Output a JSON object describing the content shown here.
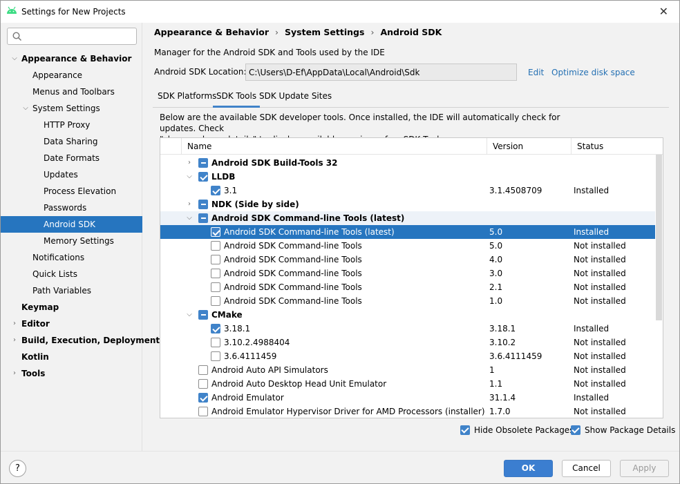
{
  "window": {
    "title": "Settings for New Projects"
  },
  "search": {
    "placeholder": "",
    "value": ""
  },
  "sidebar": {
    "items": [
      {
        "label": "Appearance & Behavior"
      },
      {
        "label": "Appearance"
      },
      {
        "label": "Menus and Toolbars"
      },
      {
        "label": "System Settings"
      },
      {
        "label": "HTTP Proxy"
      },
      {
        "label": "Data Sharing"
      },
      {
        "label": "Date Formats"
      },
      {
        "label": "Updates"
      },
      {
        "label": "Process Elevation"
      },
      {
        "label": "Passwords"
      },
      {
        "label": "Android SDK"
      },
      {
        "label": "Memory Settings"
      },
      {
        "label": "Notifications"
      },
      {
        "label": "Quick Lists"
      },
      {
        "label": "Path Variables"
      },
      {
        "label": "Keymap"
      },
      {
        "label": "Editor"
      },
      {
        "label": "Build, Execution, Deployment"
      },
      {
        "label": "Kotlin"
      },
      {
        "label": "Tools"
      }
    ]
  },
  "breadcrumb": [
    "Appearance & Behavior",
    "System Settings",
    "Android SDK"
  ],
  "main": {
    "description": "Manager for the Android SDK and Tools used by the IDE",
    "location_label": "Android SDK Location:",
    "location_value": "C:\\Users\\D-Ef\\AppData\\Local\\Android\\Sdk",
    "edit_link": "Edit",
    "optimize_link": "Optimize disk space",
    "tabs": [
      {
        "label": "SDK Platforms"
      },
      {
        "label": "SDK Tools"
      },
      {
        "label": "SDK Update Sites"
      }
    ],
    "tab_desc_1": "Below are the available SDK developer tools. Once installed, the IDE will automatically check for updates. Check",
    "tab_desc_2": "\"show package details\" to display available versions of an SDK Tool."
  },
  "table": {
    "columns": [
      "Name",
      "Version",
      "Status"
    ],
    "rows": [
      {
        "name": "Android SDK Build-Tools 32",
        "version": "",
        "status": ""
      },
      {
        "name": "LLDB",
        "version": "",
        "status": ""
      },
      {
        "name": "3.1",
        "version": "3.1.4508709",
        "status": "Installed"
      },
      {
        "name": "NDK (Side by side)",
        "version": "",
        "status": ""
      },
      {
        "name": "Android SDK Command-line Tools (latest)",
        "version": "",
        "status": ""
      },
      {
        "name": "Android SDK Command-line Tools (latest)",
        "version": "5.0",
        "status": "Installed"
      },
      {
        "name": "Android SDK Command-line Tools",
        "version": "5.0",
        "status": "Not installed"
      },
      {
        "name": "Android SDK Command-line Tools",
        "version": "4.0",
        "status": "Not installed"
      },
      {
        "name": "Android SDK Command-line Tools",
        "version": "3.0",
        "status": "Not installed"
      },
      {
        "name": "Android SDK Command-line Tools",
        "version": "2.1",
        "status": "Not installed"
      },
      {
        "name": "Android SDK Command-line Tools",
        "version": "1.0",
        "status": "Not installed"
      },
      {
        "name": "CMake",
        "version": "",
        "status": ""
      },
      {
        "name": "3.18.1",
        "version": "3.18.1",
        "status": "Installed"
      },
      {
        "name": "3.10.2.4988404",
        "version": "3.10.2",
        "status": "Not installed"
      },
      {
        "name": "3.6.4111459",
        "version": "3.6.4111459",
        "status": "Not installed"
      },
      {
        "name": "Android Auto API Simulators",
        "version": "1",
        "status": "Not installed"
      },
      {
        "name": "Android Auto Desktop Head Unit Emulator",
        "version": "1.1",
        "status": "Not installed"
      },
      {
        "name": "Android Emulator",
        "version": "31.1.4",
        "status": "Installed"
      },
      {
        "name": "Android Emulator Hypervisor Driver for AMD Processors (installer)",
        "version": "1.7.0",
        "status": "Not installed"
      }
    ]
  },
  "options": {
    "hide_obsolete": "Hide Obsolete Packages",
    "show_details": "Show Package Details"
  },
  "buttons": {
    "help": "?",
    "ok": "OK",
    "cancel": "Cancel",
    "apply": "Apply"
  },
  "colors": {
    "accent": "#2675bf",
    "link": "#2470b3",
    "primary_button": "#3b7ed0"
  }
}
